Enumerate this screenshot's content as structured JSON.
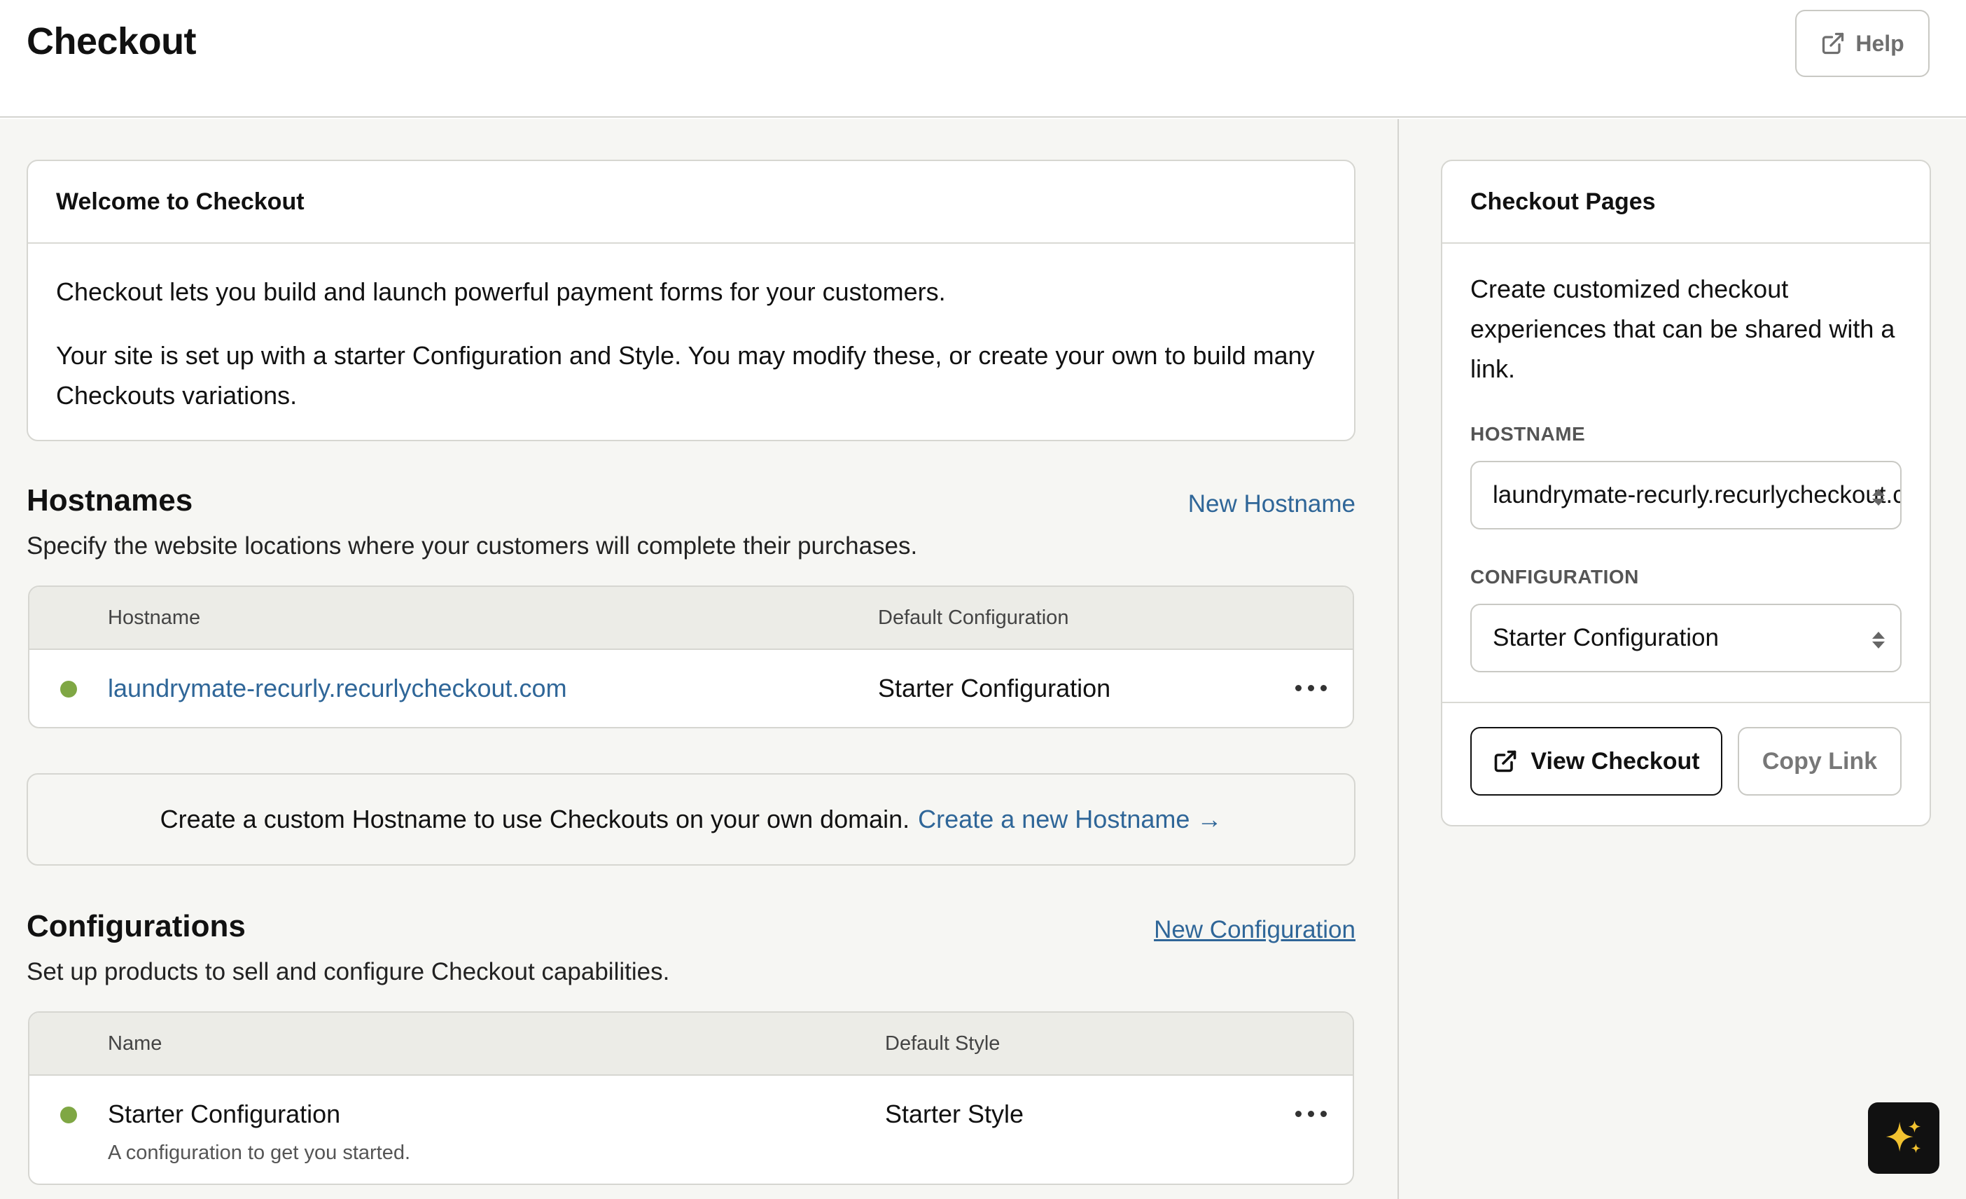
{
  "header": {
    "title": "Checkout",
    "help_label": "Help"
  },
  "welcome": {
    "title": "Welcome to Checkout",
    "paragraph1": "Checkout lets you build and launch powerful payment forms for your customers.",
    "paragraph2_line1": "Your site is set up with a starter Configuration and Style. You may modify these, or create your own to build many",
    "paragraph2_line2": "Checkouts variations."
  },
  "hostnames": {
    "title": "Hostnames",
    "subtitle": "Specify the website locations where your customers will complete their purchases.",
    "new_link": "New Hostname",
    "columns": [
      "Hostname",
      "Default Configuration"
    ],
    "rows": [
      {
        "hostname": "laundrymate-recurly.recurlycheckout.com",
        "default_configuration": "Starter Configuration"
      }
    ],
    "banner_text": "Create a custom Hostname to use Checkouts on your own domain.",
    "banner_link": "Create a new Hostname →"
  },
  "configurations": {
    "title": "Configurations",
    "subtitle": "Set up products to sell and configure Checkout capabilities.",
    "new_link": "New Configuration",
    "columns": [
      "Name",
      "Default Style"
    ],
    "rows": [
      {
        "name": "Starter Configuration",
        "description": "A configuration to get you started.",
        "default_style": "Starter Style"
      }
    ]
  },
  "checkout_pages": {
    "title": "Checkout Pages",
    "description_line1": "Create customized checkout",
    "description_line2": "experiences that can be shared with a",
    "description_line3": "link.",
    "hostname_label": "HOSTNAME",
    "hostname_value": "laundrymate-recurly.recurlycheckout.com",
    "configuration_label": "CONFIGURATION",
    "configuration_value": "Starter Configuration",
    "view_button": "View Checkout",
    "copy_button": "Copy Link"
  },
  "colors": {
    "link": "#2f6698",
    "status_active": "#7fa744",
    "sparkle": "#f2c230"
  },
  "icons": {
    "help": "external-link-icon",
    "view": "external-link-icon",
    "select": "chevron-up-down-icon",
    "row_menu": "more-horizontal-icon",
    "assistant": "sparkles-icon"
  }
}
